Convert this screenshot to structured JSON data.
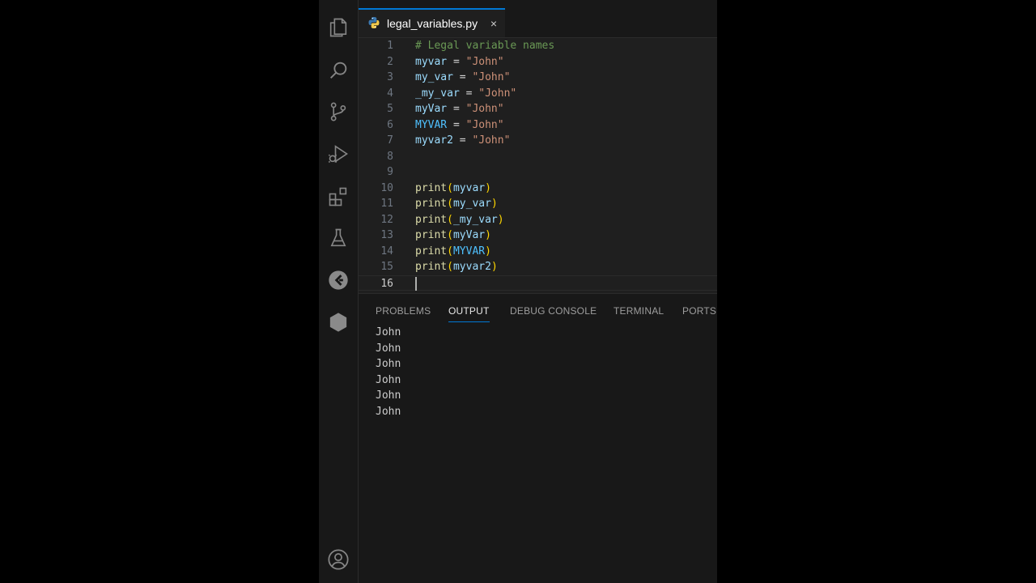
{
  "activity_bar": {
    "items": [
      {
        "name": "explorer-icon"
      },
      {
        "name": "search-icon"
      },
      {
        "name": "source-control-icon"
      },
      {
        "name": "run-debug-icon"
      },
      {
        "name": "extensions-icon"
      },
      {
        "name": "testing-icon"
      },
      {
        "name": "python-extension-icon"
      },
      {
        "name": "hexagon-icon"
      }
    ],
    "bottom": {
      "name": "account-icon"
    }
  },
  "editor": {
    "tab": {
      "label": "legal_variables.py",
      "icon": "python-file-icon",
      "close": "×",
      "active": true
    },
    "lines": [
      {
        "n": "1",
        "tokens": [
          {
            "t": "# Legal variable names",
            "c": "comment"
          }
        ]
      },
      {
        "n": "2",
        "tokens": [
          {
            "t": "myvar",
            "c": "var"
          },
          {
            "t": " = ",
            "c": "op"
          },
          {
            "t": "\"John\"",
            "c": "str"
          }
        ]
      },
      {
        "n": "3",
        "tokens": [
          {
            "t": "my_var",
            "c": "var"
          },
          {
            "t": " = ",
            "c": "op"
          },
          {
            "t": "\"John\"",
            "c": "str"
          }
        ]
      },
      {
        "n": "4",
        "tokens": [
          {
            "t": "_my_var",
            "c": "var"
          },
          {
            "t": " = ",
            "c": "op"
          },
          {
            "t": "\"John\"",
            "c": "str"
          }
        ]
      },
      {
        "n": "5",
        "tokens": [
          {
            "t": "myVar",
            "c": "var"
          },
          {
            "t": " = ",
            "c": "op"
          },
          {
            "t": "\"John\"",
            "c": "str"
          }
        ]
      },
      {
        "n": "6",
        "tokens": [
          {
            "t": "MYVAR",
            "c": "const"
          },
          {
            "t": " = ",
            "c": "op"
          },
          {
            "t": "\"John\"",
            "c": "str"
          }
        ]
      },
      {
        "n": "7",
        "tokens": [
          {
            "t": "myvar2",
            "c": "var"
          },
          {
            "t": " = ",
            "c": "op"
          },
          {
            "t": "\"John\"",
            "c": "str"
          }
        ]
      },
      {
        "n": "8",
        "tokens": []
      },
      {
        "n": "9",
        "tokens": []
      },
      {
        "n": "10",
        "tokens": [
          {
            "t": "print",
            "c": "fn"
          },
          {
            "t": "(",
            "c": "paren"
          },
          {
            "t": "myvar",
            "c": "var"
          },
          {
            "t": ")",
            "c": "paren"
          }
        ]
      },
      {
        "n": "11",
        "tokens": [
          {
            "t": "print",
            "c": "fn"
          },
          {
            "t": "(",
            "c": "paren"
          },
          {
            "t": "my_var",
            "c": "var"
          },
          {
            "t": ")",
            "c": "paren"
          }
        ]
      },
      {
        "n": "12",
        "tokens": [
          {
            "t": "print",
            "c": "fn"
          },
          {
            "t": "(",
            "c": "paren"
          },
          {
            "t": "_my_var",
            "c": "var"
          },
          {
            "t": ")",
            "c": "paren"
          }
        ]
      },
      {
        "n": "13",
        "tokens": [
          {
            "t": "print",
            "c": "fn"
          },
          {
            "t": "(",
            "c": "paren"
          },
          {
            "t": "myVar",
            "c": "var"
          },
          {
            "t": ")",
            "c": "paren"
          }
        ]
      },
      {
        "n": "14",
        "tokens": [
          {
            "t": "print",
            "c": "fn"
          },
          {
            "t": "(",
            "c": "paren"
          },
          {
            "t": "MYVAR",
            "c": "const"
          },
          {
            "t": ")",
            "c": "paren"
          }
        ]
      },
      {
        "n": "15",
        "tokens": [
          {
            "t": "print",
            "c": "fn"
          },
          {
            "t": "(",
            "c": "paren"
          },
          {
            "t": "myvar2",
            "c": "var"
          },
          {
            "t": ")",
            "c": "paren"
          }
        ]
      },
      {
        "n": "16",
        "tokens": [],
        "current": true
      }
    ]
  },
  "panel": {
    "tabs": [
      {
        "label": "PROBLEMS"
      },
      {
        "label": "OUTPUT",
        "active": true
      },
      {
        "label": "DEBUG CONSOLE"
      },
      {
        "label": "TERMINAL"
      },
      {
        "label": "PORTS"
      }
    ],
    "output_lines": [
      "John",
      "John",
      "John",
      "John",
      "John",
      "John"
    ]
  },
  "colors": {
    "accent": "#0078d4",
    "comment": "#6a9955",
    "variable": "#9cdcfe",
    "constant": "#4fc1ff",
    "string": "#ce9178",
    "function": "#dcdcaa",
    "bracket": "#ffd700"
  }
}
